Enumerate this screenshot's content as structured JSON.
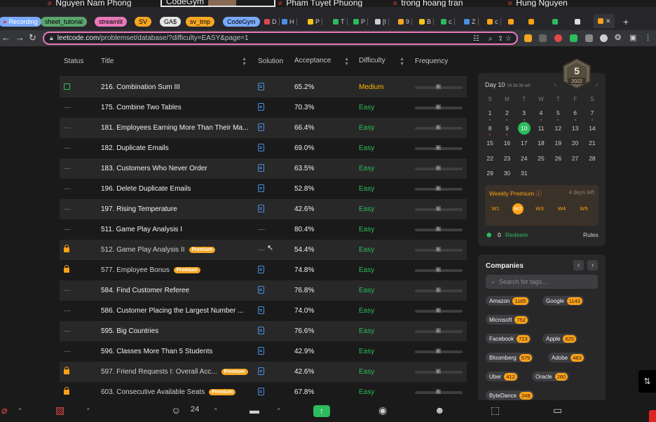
{
  "zoom_strip": {
    "participants": [
      "Nguyen Nam Phong",
      "CodeGym",
      "Pham Tuyet Phuong",
      "trong hoang tran",
      "Hung Nguyen"
    ]
  },
  "recording_label": "Recording",
  "browser": {
    "tab_groups": [
      {
        "label": "sheet_tutorial",
        "color": "#5ba56e"
      },
      {
        "label": "streamlit",
        "color": "#e879b9"
      },
      {
        "label": "SV",
        "color": "#f5a623"
      },
      {
        "label": "GA$",
        "color": "#e6e6e6"
      },
      {
        "label": "sv_tmp",
        "color": "#f5a623"
      },
      {
        "label": "CodeGym",
        "color": "#7aa9ff"
      }
    ],
    "mini_tabs": [
      "D",
      "H",
      "P",
      "T",
      "P",
      "[I",
      "9",
      "B",
      "c",
      "Z",
      "c"
    ],
    "url_host": "leetcode.com",
    "url_path": "/problemset/database/?difficulty=EASY&page=1"
  },
  "table": {
    "headers": {
      "status": "Status",
      "title": "Title",
      "solution": "Solution",
      "acceptance": "Acceptance",
      "difficulty": "Difficulty",
      "frequency": "Frequency"
    },
    "premium_label": "Premium",
    "rows": [
      {
        "status": "calendar",
        "title": "216. Combination Sum III",
        "premium": false,
        "solution": true,
        "acceptance": "65.2%",
        "difficulty": "Medium"
      },
      {
        "status": "none",
        "title": "175. Combine Two Tables",
        "premium": false,
        "solution": true,
        "acceptance": "70.3%",
        "difficulty": "Easy"
      },
      {
        "status": "none",
        "title": "181. Employees Earning More Than Their Ma...",
        "premium": false,
        "solution": true,
        "acceptance": "66.4%",
        "difficulty": "Easy"
      },
      {
        "status": "none",
        "title": "182. Duplicate Emails",
        "premium": false,
        "solution": true,
        "acceptance": "69.0%",
        "difficulty": "Easy"
      },
      {
        "status": "none",
        "title": "183. Customers Who Never Order",
        "premium": false,
        "solution": true,
        "acceptance": "63.5%",
        "difficulty": "Easy"
      },
      {
        "status": "none",
        "title": "196. Delete Duplicate Emails",
        "premium": false,
        "solution": true,
        "acceptance": "52.8%",
        "difficulty": "Easy"
      },
      {
        "status": "none",
        "title": "197. Rising Temperature",
        "premium": false,
        "solution": true,
        "acceptance": "42.6%",
        "difficulty": "Easy"
      },
      {
        "status": "none",
        "title": "511. Game Play Analysis I",
        "premium": false,
        "solution": false,
        "acceptance": "80.4%",
        "difficulty": "Easy"
      },
      {
        "status": "locked",
        "title": "512. Game Play Analysis II",
        "premium": true,
        "solution": false,
        "acceptance": "54.4%",
        "difficulty": "Easy"
      },
      {
        "status": "locked",
        "title": "577. Employee Bonus",
        "premium": true,
        "solution": true,
        "acceptance": "74.8%",
        "difficulty": "Easy"
      },
      {
        "status": "none",
        "title": "584. Find Customer Referee",
        "premium": false,
        "solution": true,
        "acceptance": "76.8%",
        "difficulty": "Easy"
      },
      {
        "status": "none",
        "title": "586. Customer Placing the Largest Number ...",
        "premium": false,
        "solution": true,
        "acceptance": "74.0%",
        "difficulty": "Easy"
      },
      {
        "status": "none",
        "title": "595. Big Countries",
        "premium": false,
        "solution": true,
        "acceptance": "76.6%",
        "difficulty": "Easy"
      },
      {
        "status": "none",
        "title": "596. Classes More Than 5 Students",
        "premium": false,
        "solution": true,
        "acceptance": "42.9%",
        "difficulty": "Easy"
      },
      {
        "status": "locked",
        "title": "597. Friend Requests I: Overall Acc...",
        "premium": true,
        "solution": true,
        "acceptance": "42.6%",
        "difficulty": "Easy"
      },
      {
        "status": "locked",
        "title": "603. Consecutive Available Seats",
        "premium": true,
        "solution": true,
        "acceptance": "67.8%",
        "difficulty": "Easy"
      }
    ]
  },
  "calendar": {
    "badge_number": "5",
    "badge_year": "2022",
    "day_label": "Day 10",
    "time_left": "09:36:36 left",
    "weekdays": [
      "S",
      "M",
      "T",
      "W",
      "T",
      "F",
      "S"
    ],
    "today": "10",
    "days": [
      "1",
      "2",
      "3",
      "4",
      "5",
      "6",
      "7",
      "8",
      "9",
      "10",
      "11",
      "12",
      "13",
      "14",
      "15",
      "16",
      "17",
      "18",
      "19",
      "20",
      "21",
      "22",
      "23",
      "24",
      "25",
      "26",
      "27",
      "28",
      "29",
      "30",
      "31"
    ],
    "red_dot_days": [
      "1",
      "2",
      "3",
      "4",
      "5",
      "6",
      "7",
      "8",
      "9"
    ],
    "weekly_title": "Weekly Premium",
    "weekly_days_left": "4 days left",
    "weeks": [
      "W1",
      "W2",
      "W3",
      "W4",
      "W5"
    ],
    "active_week": "W2",
    "coins": "0",
    "redeem_label": "Redeem",
    "rules_label": "Rules"
  },
  "companies": {
    "title": "Companies",
    "search_placeholder": "Search for tags...",
    "tags": [
      {
        "name": "Amazon",
        "count": "1165"
      },
      {
        "name": "Google",
        "count": "1143"
      },
      {
        "name": "Microsoft",
        "count": "752"
      },
      {
        "name": "Facebook",
        "count": "723"
      },
      {
        "name": "Apple",
        "count": "625"
      },
      {
        "name": "Bloomberg",
        "count": "579"
      },
      {
        "name": "Adobe",
        "count": "483"
      },
      {
        "name": "Uber",
        "count": "412"
      },
      {
        "name": "Oracle",
        "count": "260"
      },
      {
        "name": "ByteDance",
        "count": "248"
      }
    ]
  },
  "zoom_toolbar": {
    "participant_count": "24"
  },
  "colors": {
    "easy": "#2cbb5d",
    "medium": "#ffb800",
    "premium": "#ffa116",
    "address_border": "#e879b9"
  }
}
